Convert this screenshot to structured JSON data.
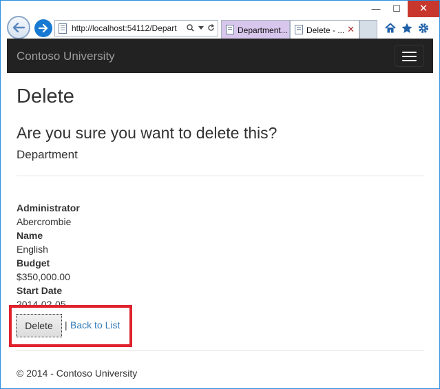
{
  "browser": {
    "url": "http://localhost:54112/Depart",
    "tabs": [
      {
        "label": "Department..."
      },
      {
        "label": "Delete - ..."
      }
    ],
    "window_controls": {
      "minimize": "—",
      "maximize": "☐",
      "close": "✕"
    },
    "icons": [
      "back-arrow-icon",
      "forward-arrow-icon",
      "search-icon",
      "dropdown-icon",
      "refresh-icon",
      "home-icon",
      "star-icon",
      "gear-icon"
    ]
  },
  "navbar": {
    "brand": "Contoso University"
  },
  "page": {
    "title": "Delete",
    "question": "Are you sure you want to delete this?",
    "entity": "Department",
    "fields": [
      {
        "label": "Administrator",
        "value": "Abercrombie"
      },
      {
        "label": "Name",
        "value": "English"
      },
      {
        "label": "Budget",
        "value": "$350,000.00"
      },
      {
        "label": "Start Date",
        "value": "2014-02-05"
      }
    ],
    "delete_label": "Delete",
    "separator": "|",
    "back_link": "Back to List"
  },
  "footer": {
    "text": "© 2014 - Contoso University"
  },
  "colors": {
    "navbar": "#222222",
    "link": "#337ab7",
    "highlight": "#e0222e",
    "close_button": "#c7372c"
  }
}
